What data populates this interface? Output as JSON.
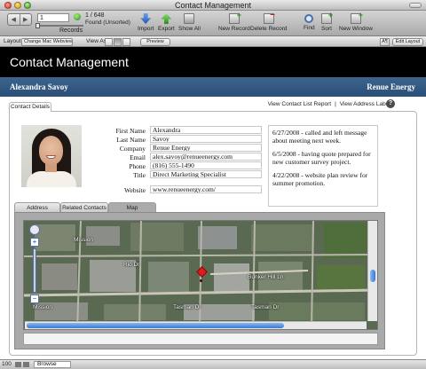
{
  "window": {
    "title": "Contact Management"
  },
  "toolbar": {
    "record_number": "1",
    "record_total": "1 / 648",
    "record_status": "Found (Unsorted)",
    "records_label": "Records",
    "tools": [
      {
        "label": "Import",
        "icon": "import-icon"
      },
      {
        "label": "Export",
        "icon": "export-icon"
      },
      {
        "label": "Show All",
        "icon": "show-all-icon"
      },
      {
        "label": "New Record",
        "icon": "new-record-icon"
      },
      {
        "label": "Delete Record",
        "icon": "delete-record-icon"
      },
      {
        "label": "Find",
        "icon": "find-icon"
      },
      {
        "label": "Sort",
        "icon": "sort-icon"
      },
      {
        "label": "New Window",
        "icon": "new-window-icon"
      }
    ]
  },
  "layout_bar": {
    "layout_label": "Layout:",
    "layout_value": "Change Mac Webviewer",
    "view_as_label": "View As:",
    "preview_label": "Preview",
    "text_size_label": "A¶",
    "edit_layout_label": "Edit Layout"
  },
  "header": {
    "title": "Contact Management"
  },
  "subbar": {
    "name": "Alexandra Savoy",
    "company": "Renue Energy"
  },
  "details_tab": "Contact Details",
  "links": {
    "list_report": "View Contact List Report",
    "sep": "|",
    "address_labels": "View Address Labels",
    "help": "?"
  },
  "fields": [
    {
      "label": "First Name",
      "value": "Alexandra"
    },
    {
      "label": "Last Name",
      "value": "Savoy"
    },
    {
      "label": "Company",
      "value": "Renue Energy"
    },
    {
      "label": "Email",
      "value": "alex.savoy@renueenergy.com"
    },
    {
      "label": "Phone",
      "value": "(816) 555-1490"
    },
    {
      "label": "Title",
      "value": "Direct Marketing Specialist"
    },
    {
      "label": "Website",
      "value": "www.renueenergy.com/"
    }
  ],
  "notes": [
    "6/27/2008 - called and left message about meeting next week.",
    "6/5/2008 - having quote prepared for new customer survey project.",
    "4/22/2008 - website plan review for summer promotion."
  ],
  "lower_tabs": [
    "Address",
    "Related Contacts",
    "Map"
  ],
  "lower_tab_active": "Map",
  "map": {
    "streets": [
      "Bunker Hill Ln",
      "Tasman Dr",
      "Tasman Dr",
      "Rio Dr",
      "Mission",
      "Mission"
    ]
  },
  "status": {
    "zoom": "100",
    "mode": "Browse"
  },
  "colors": {
    "header_bg": "#000000",
    "subbar_bg": "#2f5580",
    "marker": "#e21c1c",
    "scroll_thumb": "#3a78d2"
  }
}
